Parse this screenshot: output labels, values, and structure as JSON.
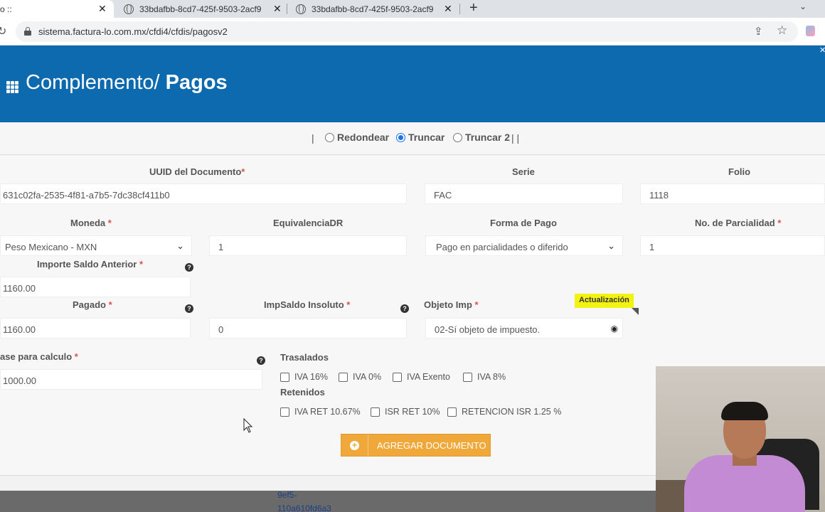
{
  "browser": {
    "tabs": [
      {
        "title": "o ::",
        "active": true
      },
      {
        "title": "33bdafbb-8cd7-425f-9503-2acf9",
        "active": false
      },
      {
        "title": "33bdafbb-8cd7-425f-9503-2acf9",
        "active": false
      }
    ],
    "new_tab_label": "+",
    "url": "sistema.factura-lo.com.mx/cfdi4/cfdis/pagosv2"
  },
  "header": {
    "title_prefix": "Complemento/ ",
    "title_bold": "Pagos"
  },
  "rounding": {
    "pipe_left": "|",
    "pipe_right": "| |",
    "options": [
      {
        "label": "Redondear",
        "checked": false
      },
      {
        "label": "Truncar",
        "checked": true
      },
      {
        "label": "Truncar 2",
        "checked": false
      }
    ]
  },
  "form": {
    "uuid": {
      "label": "UUID del Documento",
      "value": "631c02fa-2535-4f81-a7b5-7dc38cf411b0"
    },
    "serie": {
      "label": "Serie",
      "value": "FAC"
    },
    "folio": {
      "label": "Folio",
      "value": "1118"
    },
    "moneda": {
      "label": "Moneda",
      "value": "Peso Mexicano - MXN"
    },
    "equivalencia": {
      "label": "EquivalenciaDR",
      "value": "1"
    },
    "forma_pago": {
      "label": "Forma de Pago",
      "value": "Pago en parcialidades o diferido"
    },
    "parcialidad": {
      "label": "No. de Parcialidad",
      "value": "1"
    },
    "importe_saldo": {
      "label": "Importe Saldo Anterior",
      "value": "1160.00"
    },
    "pagado": {
      "label": "Pagado",
      "value": "1160.00"
    },
    "saldo_insoluto": {
      "label": "ImpSaldo Insoluto",
      "value": "0"
    },
    "objeto_imp": {
      "label": "Objeto Imp",
      "value": "02-Sí objeto de impuesto.",
      "badge": "Actualización"
    },
    "base_calculo": {
      "label": "ase para calculo",
      "value": "1000.00"
    },
    "required_mark": "*",
    "help_mark": "?",
    "trasladados": {
      "label": "Trasalados",
      "items": [
        "IVA 16%",
        "IVA 0%",
        "IVA Exento",
        "IVA 8%"
      ]
    },
    "retenidos": {
      "label": "Retenidos",
      "items": [
        "IVA RET 10.67%",
        "ISR RET 10%",
        "RETENCION ISR 1.25 %"
      ]
    },
    "add_button": "AGREGAR DOCUMENTO"
  },
  "bottom": {
    "line1": "9ef5-",
    "line2": "110a610fd6a3"
  },
  "icons": {
    "grid": "grid-icon",
    "help": "question-circle-icon",
    "eye": "eye-icon",
    "plus": "plus-circle-icon"
  },
  "colors": {
    "header_bg": "#0e6aaf",
    "button_bg": "#f0a83a",
    "badge_bg": "#f3f312",
    "required": "#d9534f"
  }
}
